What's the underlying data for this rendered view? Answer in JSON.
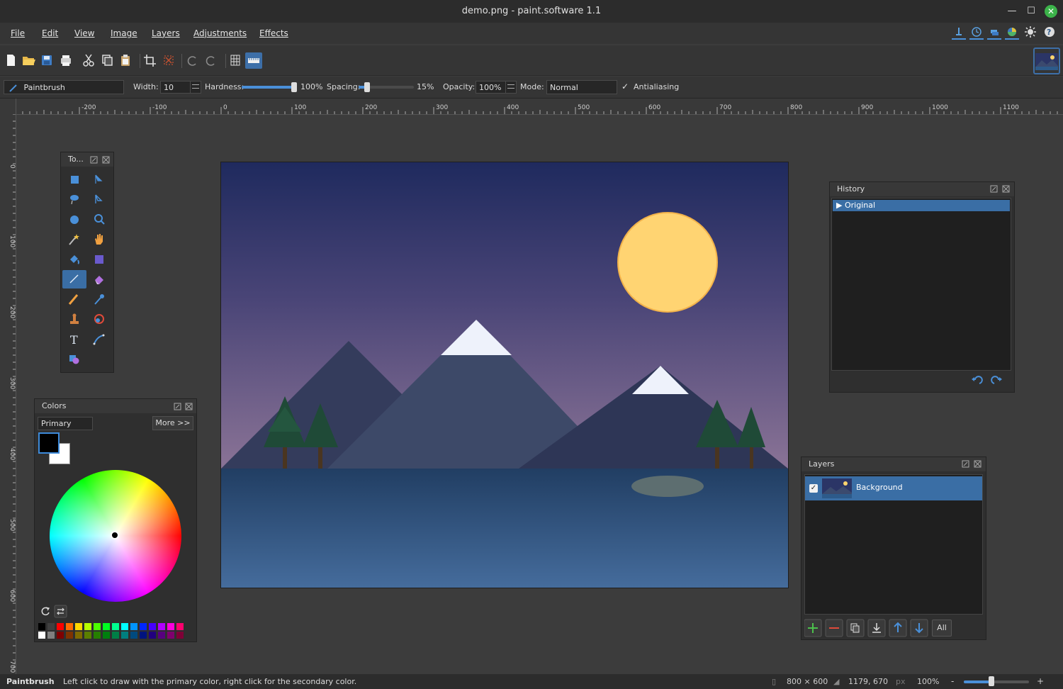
{
  "app": {
    "title": "demo.png - paint.software 1.1"
  },
  "menu": [
    "File",
    "Edit",
    "View",
    "Image",
    "Layers",
    "Adjustments",
    "Effects"
  ],
  "tool_options": {
    "tool_name": "Paintbrush",
    "width_label": "Width:",
    "width_value": "10",
    "hardness_label": "Hardness:",
    "hardness_value": "100%",
    "hardness_fraction": 1.0,
    "spacing_label": "Spacing:",
    "spacing_value": "15%",
    "spacing_fraction": 0.15,
    "opacity_label": "Opacity:",
    "opacity_value": "100%",
    "mode_label": "Mode:",
    "mode_value": "Normal",
    "antialiasing_label": "Antialiasing",
    "antialiasing_checked": true
  },
  "ruler": {
    "h_labels": [
      "-200",
      "-100",
      "0",
      "100",
      "200",
      "300",
      "400",
      "500",
      "600",
      "700",
      "800",
      "900",
      "1000",
      "1100"
    ],
    "v_labels": [
      "0",
      "100",
      "200",
      "300",
      "400",
      "500",
      "600",
      "700"
    ]
  },
  "tools_panel": {
    "title": "To...",
    "tools": [
      "rectangle-select",
      "move-selection",
      "lasso-select",
      "move-selected",
      "ellipse-select",
      "zoom",
      "magic-wand",
      "pan",
      "paint-bucket",
      "gradient",
      "paintbrush",
      "eraser",
      "pencil",
      "color-picker",
      "clone-stamp",
      "recolor",
      "text",
      "line-curve",
      "shapes"
    ],
    "active_tool": "paintbrush"
  },
  "colors_panel": {
    "title": "Colors",
    "mode_value": "Primary",
    "more_label": "More >>",
    "primary_color": "#000000",
    "secondary_color": "#ffffff",
    "palette_top": [
      "#000000",
      "#404040",
      "#ff0000",
      "#ff6a00",
      "#ffd800",
      "#b6ff00",
      "#4cff00",
      "#00ff21",
      "#00ff90",
      "#00ffff",
      "#0094ff",
      "#0026ff",
      "#4800ff",
      "#b200ff",
      "#ff00dc",
      "#ff006e"
    ],
    "palette_bottom": [
      "#ffffff",
      "#808080",
      "#7f0000",
      "#7f3300",
      "#7f6a00",
      "#5b7f00",
      "#267f00",
      "#007f0e",
      "#007f46",
      "#007f7f",
      "#004a7f",
      "#00137f",
      "#21007f",
      "#57007f",
      "#7f006e",
      "#7f0037"
    ]
  },
  "history_panel": {
    "title": "History",
    "items": [
      "Original"
    ]
  },
  "layers_panel": {
    "title": "Layers",
    "layers": [
      {
        "name": "Background",
        "visible": true
      }
    ],
    "all_label": "All"
  },
  "status": {
    "tool": "Paintbrush",
    "hint": "Left click to draw with the primary color, right click for the secondary color.",
    "image_size": "800 × 600",
    "cursor_pos": "1179, 670",
    "unit": "px",
    "zoom": "100%",
    "zoom_fraction": 0.42
  },
  "colors": {
    "accent": "#3d6fa8",
    "selection": "#3a6ea5"
  }
}
